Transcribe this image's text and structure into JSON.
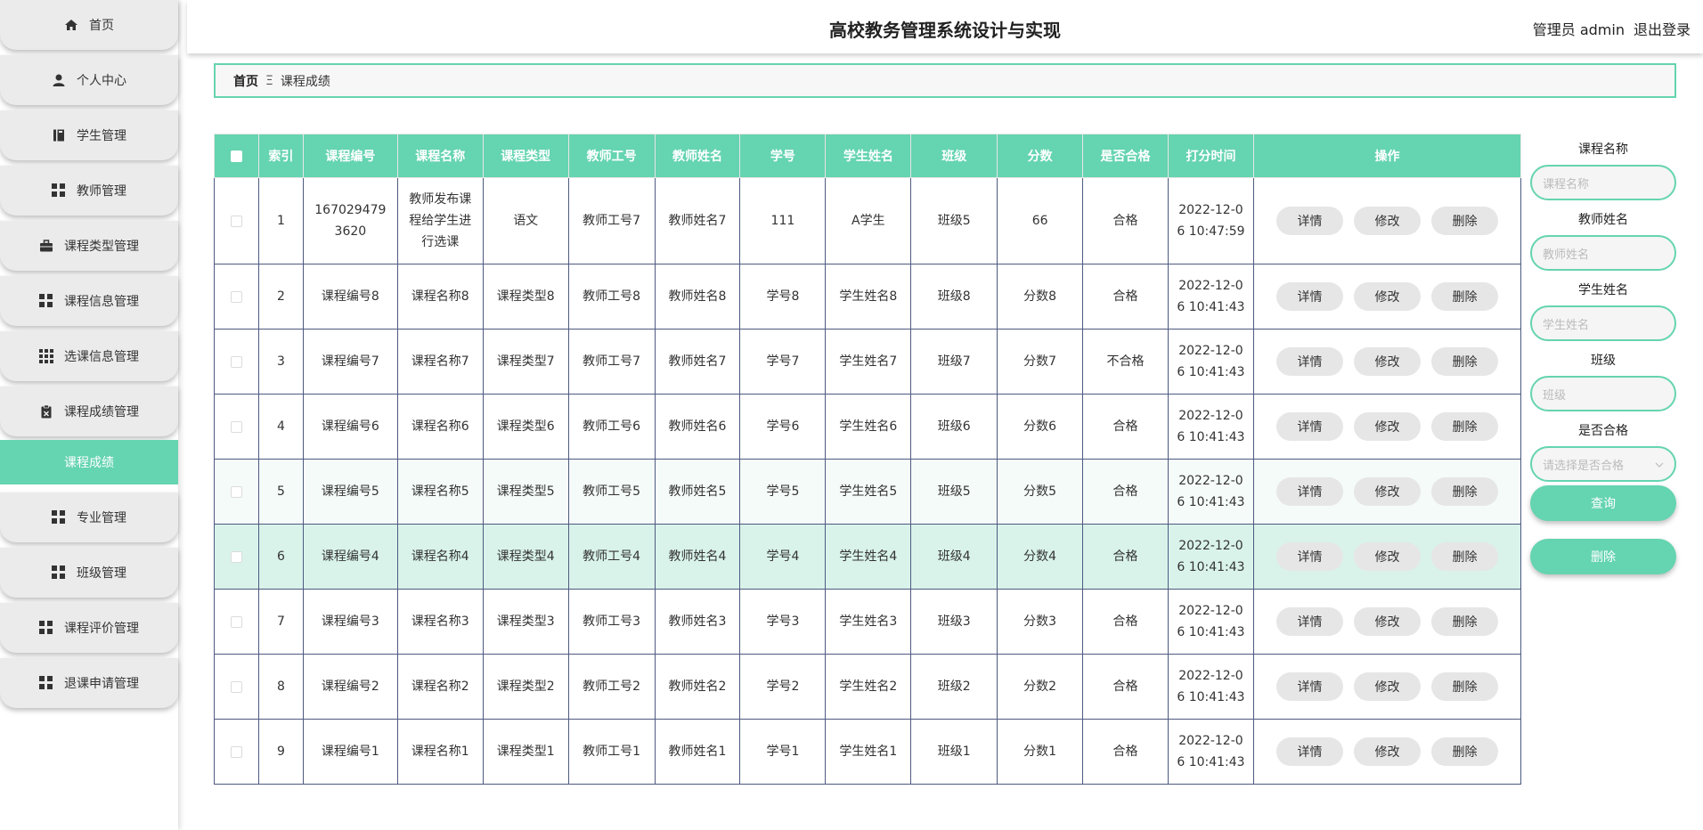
{
  "header": {
    "title": "高校教务管理系统设计与实现",
    "user_label": "管理员 admin",
    "logout_label": "退出登录"
  },
  "sidebar": {
    "items": [
      {
        "label": "首页",
        "icon": "home-icon"
      },
      {
        "label": "个人中心",
        "icon": "user-icon"
      },
      {
        "label": "学生管理",
        "icon": "book-icon"
      },
      {
        "label": "教师管理",
        "icon": "grid-icon"
      },
      {
        "label": "课程类型管理",
        "icon": "briefcase-icon"
      },
      {
        "label": "课程信息管理",
        "icon": "grid-icon"
      },
      {
        "label": "选课信息管理",
        "icon": "grid9-icon"
      },
      {
        "label": "课程成绩管理",
        "icon": "clipboard-icon"
      }
    ],
    "active_sub": "课程成绩",
    "items2": [
      {
        "label": "专业管理",
        "icon": "grid-icon"
      },
      {
        "label": "班级管理",
        "icon": "grid-icon"
      },
      {
        "label": "课程评价管理",
        "icon": "grid-icon"
      },
      {
        "label": "退课申请管理",
        "icon": "grid-icon"
      }
    ]
  },
  "breadcrumb": {
    "home": "首页",
    "separator": "Ξ",
    "current": "课程成绩"
  },
  "table": {
    "headers": [
      "索引",
      "课程编号",
      "课程名称",
      "课程类型",
      "教师工号",
      "教师姓名",
      "学号",
      "学生姓名",
      "班级",
      "分数",
      "是否合格",
      "打分时间",
      "操作"
    ],
    "rows": [
      {
        "index": "1",
        "course_no": "1670294793620",
        "course_name": "教师发布课程给学生进行选课",
        "course_type": "语文",
        "teacher_no": "教师工号7",
        "teacher_name": "教师姓名7",
        "student_no": "111",
        "student_name": "A学生",
        "class": "班级5",
        "score": "66",
        "pass": "合格",
        "time": "2022-12-06 10:47:59"
      },
      {
        "index": "2",
        "course_no": "课程编号8",
        "course_name": "课程名称8",
        "course_type": "课程类型8",
        "teacher_no": "教师工号8",
        "teacher_name": "教师姓名8",
        "student_no": "学号8",
        "student_name": "学生姓名8",
        "class": "班级8",
        "score": "分数8",
        "pass": "合格",
        "time": "2022-12-06 10:41:43"
      },
      {
        "index": "3",
        "course_no": "课程编号7",
        "course_name": "课程名称7",
        "course_type": "课程类型7",
        "teacher_no": "教师工号7",
        "teacher_name": "教师姓名7",
        "student_no": "学号7",
        "student_name": "学生姓名7",
        "class": "班级7",
        "score": "分数7",
        "pass": "不合格",
        "time": "2022-12-06 10:41:43"
      },
      {
        "index": "4",
        "course_no": "课程编号6",
        "course_name": "课程名称6",
        "course_type": "课程类型6",
        "teacher_no": "教师工号6",
        "teacher_name": "教师姓名6",
        "student_no": "学号6",
        "student_name": "学生姓名6",
        "class": "班级6",
        "score": "分数6",
        "pass": "合格",
        "time": "2022-12-06 10:41:43"
      },
      {
        "index": "5",
        "course_no": "课程编号5",
        "course_name": "课程名称5",
        "course_type": "课程类型5",
        "teacher_no": "教师工号5",
        "teacher_name": "教师姓名5",
        "student_no": "学号5",
        "student_name": "学生姓名5",
        "class": "班级5",
        "score": "分数5",
        "pass": "合格",
        "time": "2022-12-06 10:41:43"
      },
      {
        "index": "6",
        "course_no": "课程编号4",
        "course_name": "课程名称4",
        "course_type": "课程类型4",
        "teacher_no": "教师工号4",
        "teacher_name": "教师姓名4",
        "student_no": "学号4",
        "student_name": "学生姓名4",
        "class": "班级4",
        "score": "分数4",
        "pass": "合格",
        "time": "2022-12-06 10:41:43"
      },
      {
        "index": "7",
        "course_no": "课程编号3",
        "course_name": "课程名称3",
        "course_type": "课程类型3",
        "teacher_no": "教师工号3",
        "teacher_name": "教师姓名3",
        "student_no": "学号3",
        "student_name": "学生姓名3",
        "class": "班级3",
        "score": "分数3",
        "pass": "合格",
        "time": "2022-12-06 10:41:43"
      },
      {
        "index": "8",
        "course_no": "课程编号2",
        "course_name": "课程名称2",
        "course_type": "课程类型2",
        "teacher_no": "教师工号2",
        "teacher_name": "教师姓名2",
        "student_no": "学号2",
        "student_name": "学生姓名2",
        "class": "班级2",
        "score": "分数2",
        "pass": "合格",
        "time": "2022-12-06 10:41:43"
      },
      {
        "index": "9",
        "course_no": "课程编号1",
        "course_name": "课程名称1",
        "course_type": "课程类型1",
        "teacher_no": "教师工号1",
        "teacher_name": "教师姓名1",
        "student_no": "学号1",
        "student_name": "学生姓名1",
        "class": "班级1",
        "score": "分数1",
        "pass": "合格",
        "time": "2022-12-06 10:41:43"
      }
    ],
    "actions": {
      "detail": "详情",
      "edit": "修改",
      "delete": "删除"
    }
  },
  "search": {
    "course_name_label": "课程名称",
    "course_name_placeholder": "课程名称",
    "teacher_name_label": "教师姓名",
    "teacher_name_placeholder": "教师姓名",
    "student_name_label": "学生姓名",
    "student_name_placeholder": "学生姓名",
    "class_label": "班级",
    "class_placeholder": "班级",
    "pass_label": "是否合格",
    "pass_placeholder": "请选择是否合格",
    "query_button": "查询",
    "delete_button": "删除"
  },
  "colors": {
    "accent": "#65d4b0",
    "highlight_row": "#d9f3ea",
    "nav_bg": "#ebebeb"
  }
}
